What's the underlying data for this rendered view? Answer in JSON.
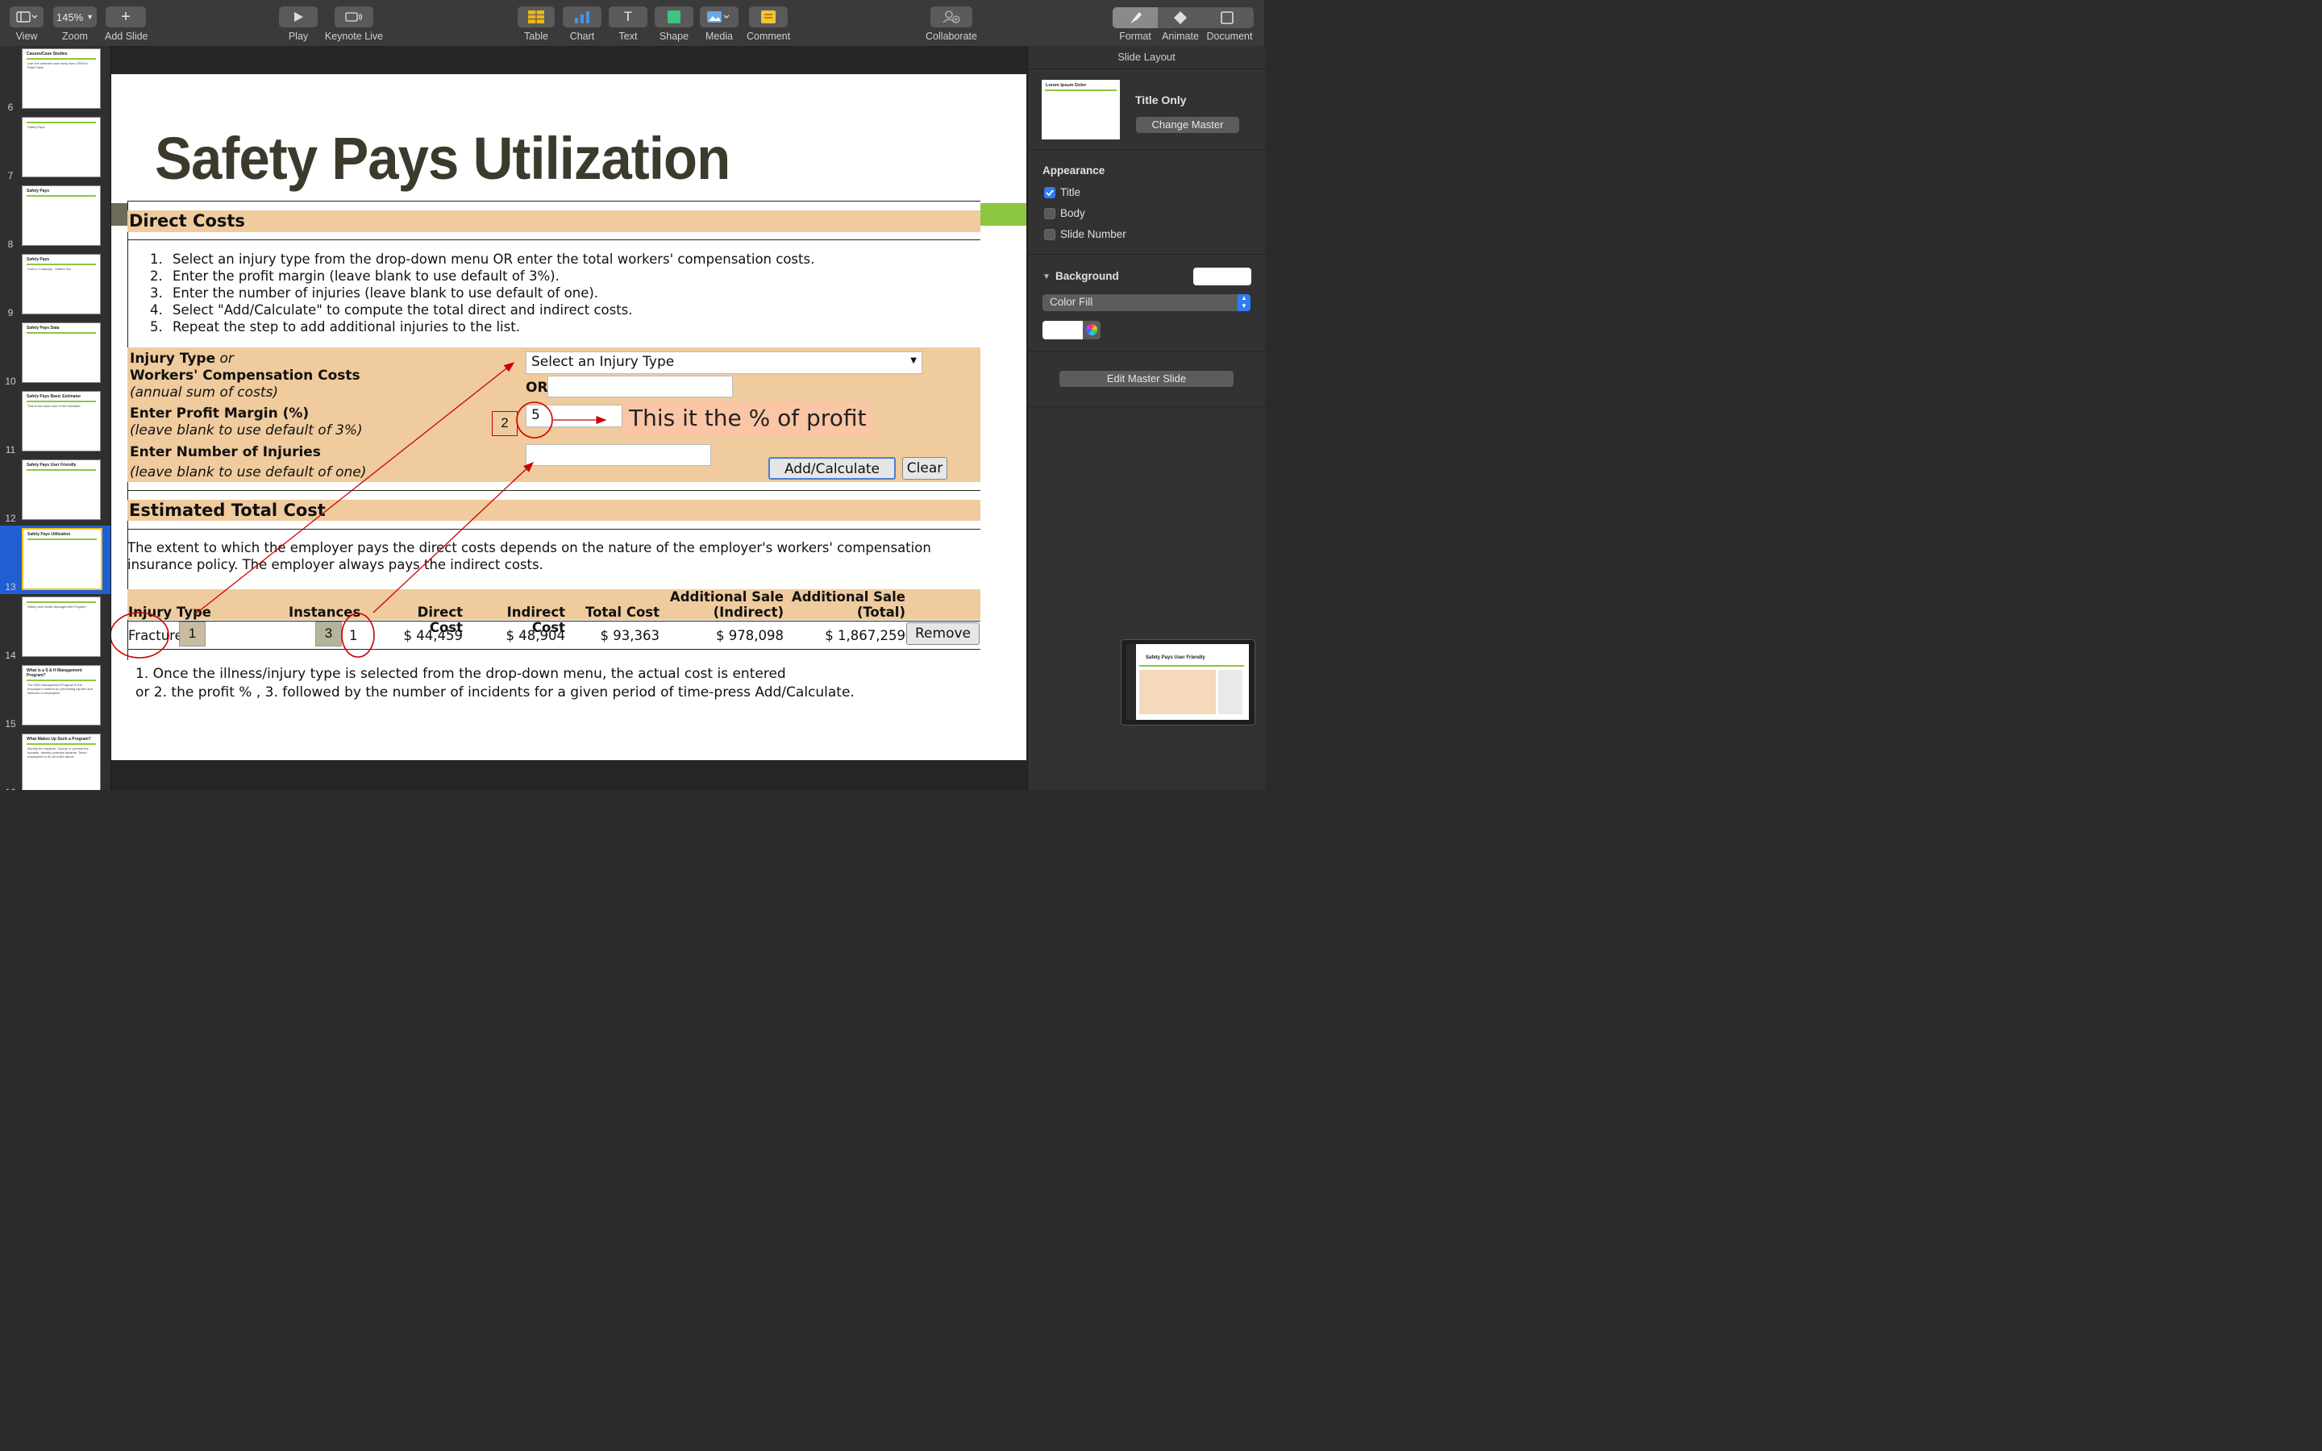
{
  "toolbar": {
    "view": "View",
    "zoom_value": "145%",
    "zoom": "Zoom",
    "add_slide": "Add Slide",
    "play": "Play",
    "keynote_live": "Keynote Live",
    "table": "Table",
    "chart": "Chart",
    "text": "Text",
    "shape": "Shape",
    "media": "Media",
    "comment": "Comment",
    "collaborate": "Collaborate",
    "format": "Format",
    "animate": "Animate",
    "document": "Document"
  },
  "navigator": {
    "slides": [
      {
        "num": "6",
        "title": "Causes/Case Studies",
        "body": "Use one relevant case study from OSHA's Fatal Facts"
      },
      {
        "num": "7",
        "title": "",
        "body": "Safety Pays"
      },
      {
        "num": "8",
        "title": "Safety Pays",
        "body": ""
      },
      {
        "num": "9",
        "title": "Safety Pays",
        "body": "Cost to Company - bottom line"
      },
      {
        "num": "10",
        "title": "Safety Pays Data",
        "body": ""
      },
      {
        "num": "11",
        "title": "Safety Pays Basic Estimator",
        "body": "This is the basic look of the estimator"
      },
      {
        "num": "12",
        "title": "Safety Pays User Friendly",
        "body": ""
      },
      {
        "num": "13",
        "title": "Safety Pays Utilization",
        "body": ""
      },
      {
        "num": "14",
        "title": "",
        "body": "Safety and Health Management Program"
      },
      {
        "num": "15",
        "title": "What is a S & H Management Program?",
        "body": "The S&H Management Program is the employer's method for preventing injuries and illnesses to employees"
      },
      {
        "num": "16",
        "title": "What Makes Up Such a Program?",
        "body": "Identify the hazards. Control or prevent the hazards. Identify potential hazards. Teach employees to do all of the above"
      }
    ]
  },
  "slide": {
    "title": "Safety Pays Utilization",
    "direct_costs": "Direct Costs",
    "steps": [
      {
        "n": "1.",
        "text": "Select an injury type from the drop-down menu OR enter the total workers' compensation costs."
      },
      {
        "n": "2.",
        "text": "Enter the profit margin (leave blank to use default of 3%)."
      },
      {
        "n": "3.",
        "text": "Enter the number of injuries (leave blank to use default of one)."
      },
      {
        "n": "4.",
        "text": "Select \"Add/Calculate\" to compute the total direct and indirect costs."
      },
      {
        "n": "5.",
        "text": "Repeat the step to add additional injuries to the list."
      }
    ],
    "injury_type_label": "Injury Type",
    "or_word": "or",
    "workers_comp_label": "Workers' Compensation Costs",
    "annual_sum": "(annual sum of costs)",
    "profit_margin_label": "Enter Profit Margin (%)",
    "profit_default": "(leave blank to use default of 3%)",
    "num_injuries_label": "Enter Number of Injuries",
    "injuries_default": "(leave blank to use default of one)",
    "select_placeholder": "Select an Injury Type",
    "or_label": "OR",
    "profit_value": "5",
    "add_calculate": "Add/Calculate",
    "clear": "Clear",
    "estimated_total": "Estimated Total Cost",
    "paragraph": "The extent to which the employer pays the direct costs depends on the nature of the employer's workers' compensation insurance policy. The employer always pays the indirect costs.",
    "table_headers": {
      "injury_type": "Injury Type",
      "instances": "Instances",
      "direct": "Direct Cost",
      "indirect": "Indirect Cost",
      "total": "Total Cost",
      "add_sale_ind_1": "Additional Sale",
      "add_sale_ind_2": "(Indirect)",
      "add_sale_tot_1": "Additional Sale",
      "add_sale_tot_2": "(Total)"
    },
    "row": {
      "injury": "Fracture",
      "instances": "1",
      "direct": "$ 44,459",
      "indirect": "$ 48,904",
      "total": "$ 93,363",
      "add_ind": "$ 978,098",
      "add_tot": "$ 1,867,259",
      "remove": "Remove"
    },
    "annotations": {
      "box1": "1",
      "box2": "2",
      "box3": "3",
      "callout": "This it the % of profit"
    },
    "note_line1": "1. Once the illness/injury type is selected from the drop-down menu, the actual cost is entered",
    "note_line2": "or 2. the profit % , 3. followed by the number of incidents for a given period of time-press Add/Calculate."
  },
  "inspector": {
    "header": "Slide Layout",
    "master_thumb_title": "Lorem Ipsum Dolor",
    "master_name": "Title Only",
    "change_master": "Change Master",
    "appearance": "Appearance",
    "title_opt": "Title",
    "body_opt": "Body",
    "slide_number_opt": "Slide Number",
    "background": "Background",
    "fill_type": "Color Fill",
    "edit_master": "Edit Master Slide",
    "mini_title": "Safety Pays User Friendly"
  },
  "colors": {
    "band": "#efcb9d",
    "accent_green": "#8dc63f",
    "title": "#3b3a2c",
    "annotation": "#cc0000",
    "selection": "#1f5fd1"
  }
}
